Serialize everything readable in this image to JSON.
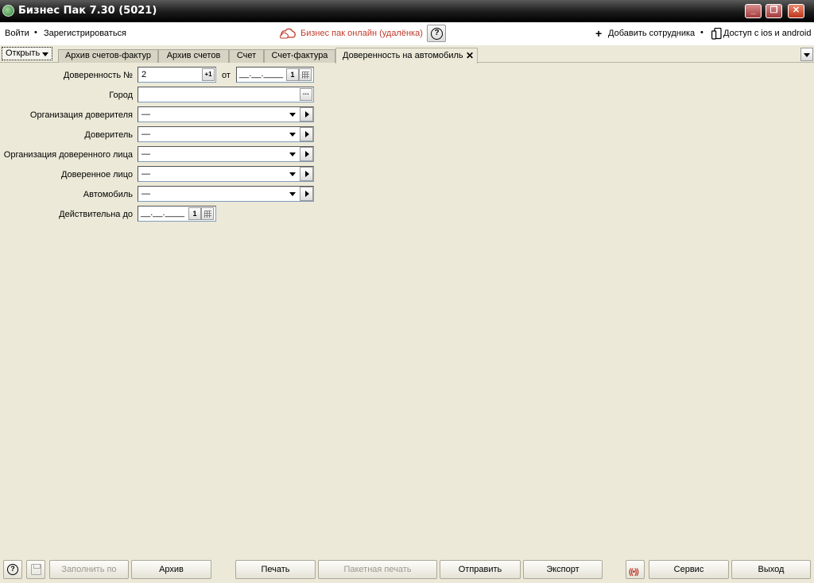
{
  "window": {
    "title": "Бизнес Пак 7.30 (5021)",
    "min_glyph": "_",
    "max_glyph": "❐",
    "close_glyph": "✕"
  },
  "topbar": {
    "login": "Войти",
    "separator": "•",
    "register": "Зарегистрироваться",
    "online": "Бизнес пак онлайн (удалёнка)",
    "help_glyph": "?",
    "add_employee_glyph": "+",
    "add_employee": "Добавить сотрудника",
    "mobile_access": "Доступ с ios и android"
  },
  "tabs": {
    "open_label": "Открыть",
    "items": [
      {
        "label": "Архив счетов-фактур"
      },
      {
        "label": "Архив счетов"
      },
      {
        "label": "Счет"
      },
      {
        "label": "Счет-фактура"
      },
      {
        "label": "Доверенность на автомобиль",
        "active": true
      }
    ],
    "close_glyph": "✕"
  },
  "form": {
    "number_label": "Доверенность №",
    "number_value": "2",
    "increment_label": "+1",
    "from_label": "от",
    "date_mask": "__.__.____",
    "date_btn_label": "1",
    "city_label": "Город",
    "city_value": "",
    "city_btn_label": "···",
    "principal_org_label": "Организация доверителя",
    "principal_org_value": "—",
    "principal_label": "Доверитель",
    "principal_value": "—",
    "agent_org_label": "Организация доверенного лица",
    "agent_org_value": "—",
    "agent_label": "Доверенное лицо",
    "agent_value": "—",
    "car_label": "Автомобиль",
    "car_value": "—",
    "valid_until_label": "Действительна до",
    "valid_until_mask": "__.__.____",
    "valid_until_btn_label": "1"
  },
  "bottom": {
    "help_glyph": "?",
    "fill_by": "Заполнить по",
    "archive": "Архив",
    "print": "Печать",
    "batch_print": "Пакетная печать",
    "send": "Отправить",
    "export": "Экспорт",
    "signal_glyph": "((•))",
    "service": "Сервис",
    "exit": "Выход"
  },
  "colors": {
    "background": "#ece9d8",
    "online_link": "#c0392b",
    "disabled_text": "#9a998e"
  }
}
